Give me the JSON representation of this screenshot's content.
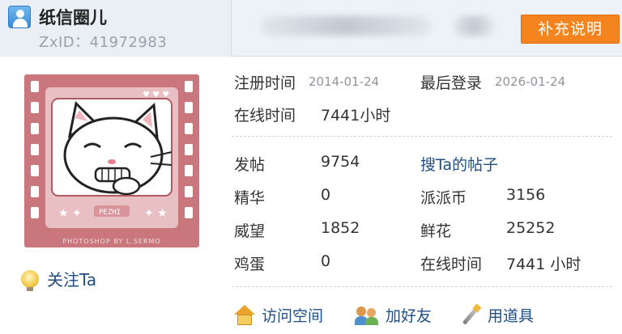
{
  "header": {
    "username": "纸信圈儿",
    "zxid": "ZxID：41972983",
    "supplement_button": "补充说明"
  },
  "profile": {
    "avatar_caption": "PHOTOSHOP BY L.SERMO",
    "follow_label": "关注Ta"
  },
  "stats": {
    "register_label": "注册时间",
    "register_date": "2014-01-24",
    "last_login_label": "最后登录",
    "last_login_date": "2026-01-24",
    "online_label": "在线时间",
    "online_value": "7441小时",
    "posts_label": "发帖",
    "posts_value": "9754",
    "search_posts_link": "搜Ta的帖子",
    "elite_label": "精华",
    "elite_value": "0",
    "coins_label": "派派币",
    "coins_value": "3156",
    "prestige_label": "威望",
    "prestige_value": "1852",
    "flowers_label": "鲜花",
    "flowers_value": "25252",
    "eggs_label": "鸡蛋",
    "eggs_value": "0",
    "online2_label": "在线时间",
    "online2_value": "7441 小时"
  },
  "actions": {
    "visit_space": "访问空间",
    "add_friend": "加好友",
    "use_item": "用道具"
  }
}
